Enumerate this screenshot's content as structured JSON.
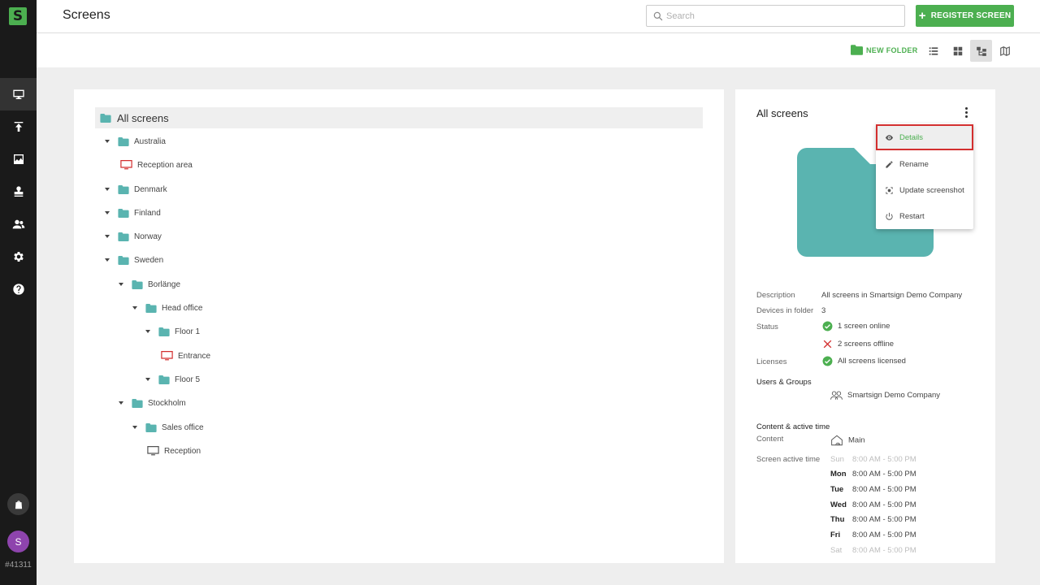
{
  "app": {
    "logo_letter": "S",
    "account_id": "#41311",
    "avatar_initial": "S",
    "accent_color": "#4caf50",
    "folder_color": "#5ab4b0",
    "offline_color": "#d32f2f"
  },
  "sidebar": {
    "items": [
      {
        "name": "screens",
        "icon": "monitor-icon",
        "active": true
      },
      {
        "name": "upload",
        "icon": "upload-icon",
        "active": false
      },
      {
        "name": "media",
        "icon": "image-icon",
        "active": false
      },
      {
        "name": "stamp",
        "icon": "stamp-icon",
        "active": false
      },
      {
        "name": "users",
        "icon": "users-icon",
        "active": false
      },
      {
        "name": "settings",
        "icon": "gear-icon",
        "active": false
      },
      {
        "name": "help",
        "icon": "help-icon",
        "active": false
      }
    ]
  },
  "header": {
    "title": "Screens",
    "search_placeholder": "Search",
    "register_label": "REGISTER SCREEN"
  },
  "toolbar": {
    "new_folder_label": "NEW FOLDER",
    "view_modes": [
      "list-view",
      "grid-view",
      "tree-view",
      "map-view"
    ],
    "active_view": "tree-view"
  },
  "tree": {
    "root_label": "All screens",
    "rows": [
      {
        "label": "Australia",
        "type": "folder",
        "expanded": true
      },
      {
        "label": "Reception area",
        "type": "screen",
        "status": "offline"
      },
      {
        "label": "Denmark",
        "type": "folder",
        "expanded": true
      },
      {
        "label": "Finland",
        "type": "folder",
        "expanded": true
      },
      {
        "label": "Norway",
        "type": "folder",
        "expanded": true
      },
      {
        "label": "Sweden",
        "type": "folder",
        "expanded": true
      },
      {
        "label": "Borlänge",
        "type": "folder",
        "expanded": true
      },
      {
        "label": "Head office",
        "type": "folder",
        "expanded": true
      },
      {
        "label": "Floor 1",
        "type": "folder",
        "expanded": true
      },
      {
        "label": "Entrance",
        "type": "screen",
        "status": "offline"
      },
      {
        "label": "Floor 5",
        "type": "folder",
        "expanded": true
      },
      {
        "label": "Stockholm",
        "type": "folder",
        "expanded": true
      },
      {
        "label": "Sales office",
        "type": "folder",
        "expanded": true
      },
      {
        "label": "Reception",
        "type": "screen",
        "status": "online"
      }
    ]
  },
  "details": {
    "title": "All screens",
    "description_label": "Description",
    "description_value": "All screens in Smartsign Demo Company",
    "devices_label": "Devices in folder",
    "devices_value": "3",
    "status_label": "Status",
    "status_online": "1 screen online",
    "status_offline": "2 screens offline",
    "licenses_label": "Licenses",
    "licenses_value": "All screens licensed",
    "users_groups_label": "Users & Groups",
    "users_groups_value": "Smartsign Demo Company",
    "content_section_label": "Content & active time",
    "content_label": "Content",
    "content_value": "Main",
    "active_time_label": "Screen active time",
    "schedule": [
      {
        "day": "Sun",
        "time": "8:00 AM - 5:00 PM",
        "active": false
      },
      {
        "day": "Mon",
        "time": "8:00 AM - 5:00 PM",
        "active": true
      },
      {
        "day": "Tue",
        "time": "8:00 AM - 5:00 PM",
        "active": true
      },
      {
        "day": "Wed",
        "time": "8:00 AM - 5:00 PM",
        "active": true
      },
      {
        "day": "Thu",
        "time": "8:00 AM - 5:00 PM",
        "active": true
      },
      {
        "day": "Fri",
        "time": "8:00 AM - 5:00 PM",
        "active": true
      },
      {
        "day": "Sat",
        "time": "8:00 AM - 5:00 PM",
        "active": false
      }
    ]
  },
  "context_menu": {
    "items": [
      {
        "label": "Details",
        "icon": "eye-icon",
        "highlighted": true
      },
      {
        "label": "Rename",
        "icon": "pencil-icon",
        "highlighted": false
      },
      {
        "label": "Update screenshot",
        "icon": "screenshot-icon",
        "highlighted": false
      },
      {
        "label": "Restart",
        "icon": "power-icon",
        "highlighted": false
      }
    ]
  }
}
